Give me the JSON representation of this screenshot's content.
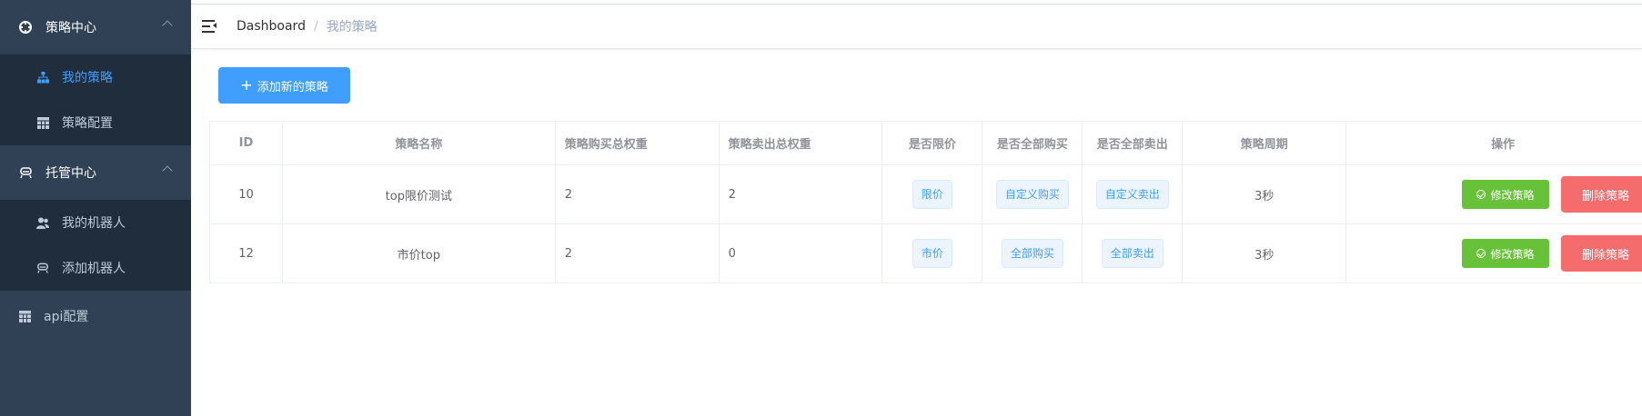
{
  "sidebar": {
    "groups": [
      {
        "label": "策略中心",
        "items": [
          {
            "label": "我的策略"
          },
          {
            "label": "策略配置"
          }
        ]
      },
      {
        "label": "托管中心",
        "items": [
          {
            "label": "我的机器人"
          },
          {
            "label": "添加机器人"
          }
        ]
      }
    ],
    "api_config": "api配置"
  },
  "breadcrumb": {
    "home": "Dashboard",
    "separator": "/",
    "current": "我的策略"
  },
  "actions": {
    "add_strategy": "添加新的策略"
  },
  "table": {
    "headers": [
      "ID",
      "策略名称",
      "策略购买总权重",
      "策略卖出总权重",
      "是否限价",
      "是否全部购买",
      "是否全部卖出",
      "策略周期",
      "操作"
    ],
    "rows": [
      {
        "id": "10",
        "name": "top限价测试",
        "buy_weight": "2",
        "sell_weight": "2",
        "limit": "限价",
        "buy_all": "自定义购买",
        "sell_all": "自定义卖出",
        "period": "3秒",
        "edit": "修改策略",
        "delete": "删除策略"
      },
      {
        "id": "12",
        "name": "市价top",
        "buy_weight": "2",
        "sell_weight": "0",
        "limit": "市价",
        "buy_all": "全部购买",
        "sell_all": "全部卖出",
        "period": "3秒",
        "edit": "修改策略",
        "delete": "删除策略"
      }
    ]
  },
  "colors": {
    "sidebar_bg": "#304156",
    "submenu_bg": "#1f2d3d",
    "primary": "#409eff",
    "success": "#67c23a",
    "danger": "#f56c6c"
  }
}
